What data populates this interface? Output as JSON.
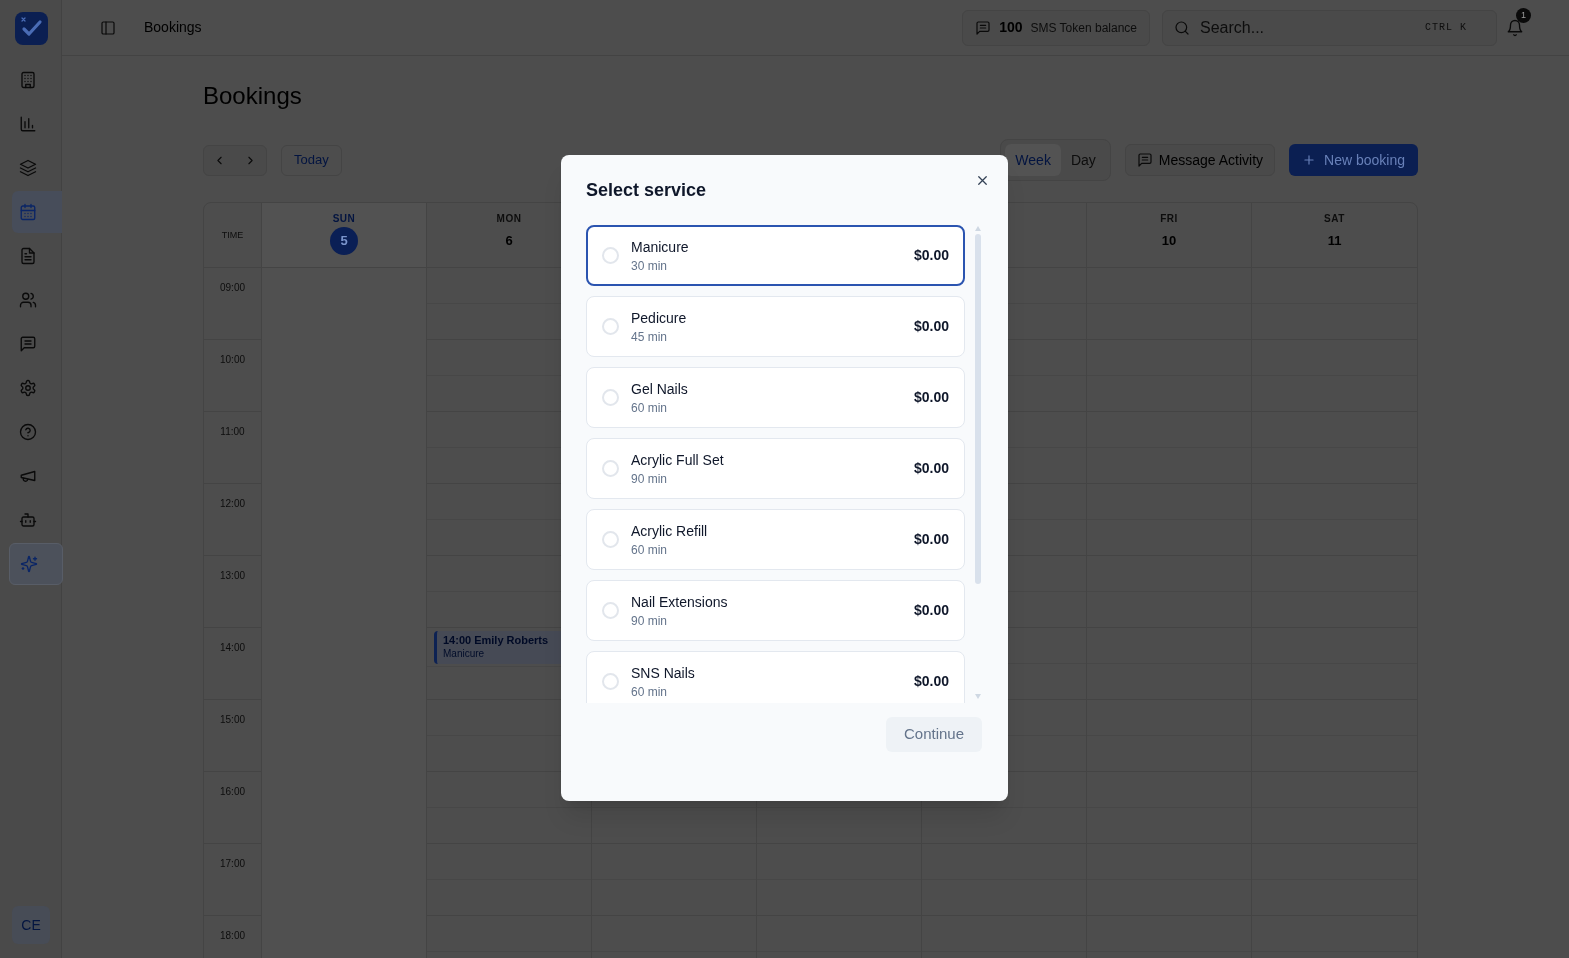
{
  "sidebar": {
    "items": [
      {
        "kind": "nav",
        "selected": false
      },
      {
        "kind": "nav",
        "selected": false
      },
      {
        "kind": "nav",
        "selected": false
      },
      {
        "kind": "nav",
        "selected": true
      },
      {
        "kind": "nav",
        "selected": false
      },
      {
        "kind": "nav",
        "selected": false
      },
      {
        "kind": "nav",
        "selected": false
      },
      {
        "kind": "nav",
        "selected": false
      },
      {
        "kind": "nav",
        "selected": false
      },
      {
        "kind": "nav",
        "selected": false
      },
      {
        "kind": "nav",
        "selected": false
      },
      {
        "kind": "assistant",
        "selected": false
      }
    ],
    "avatar": {
      "initials": "CE"
    }
  },
  "top_bar": {
    "title": "Bookings",
    "sms_balance": {
      "count": "100",
      "label": "SMS Token balance"
    },
    "search": {
      "placeholder": "Search...",
      "shortcut": "CTRL K"
    },
    "notifications": {
      "badge": "1"
    }
  },
  "page": {
    "heading": "Bookings"
  },
  "toolbar": {
    "today": "Today",
    "views": [
      {
        "label": "Week",
        "selected": true
      },
      {
        "label": "Day",
        "selected": false
      }
    ],
    "buttons": [
      {
        "kind": "secondary",
        "label": "Message Activity"
      },
      {
        "kind": "primary",
        "label": "New booking"
      }
    ]
  },
  "calendar": {
    "time_heading": "TIME",
    "days": [
      {
        "name": "SUN",
        "number": "5",
        "today": true
      },
      {
        "name": "MON",
        "number": "6",
        "today": false,
        "bookings": [
          {
            "time": "14:00",
            "client": "Emily Roberts",
            "service": "Manicure"
          }
        ]
      },
      {
        "name": "FRI",
        "number": "10",
        "today": false
      },
      {
        "name": "SAT",
        "number": "11",
        "today": false
      }
    ],
    "hours": [
      "09:00",
      "10:00",
      "11:00",
      "12:00",
      "13:00",
      "14:00",
      "15:00",
      "16:00",
      "17:00",
      "18:00"
    ]
  },
  "modal": {
    "title": "Select service",
    "services": [
      {
        "name": "Manicure",
        "duration": "30 min",
        "price": "$0.00",
        "selected": false,
        "focused": true
      },
      {
        "name": "Pedicure",
        "duration": "45 min",
        "price": "$0.00",
        "selected": false,
        "focused": false
      },
      {
        "name": "Gel Nails",
        "duration": "60 min",
        "price": "$0.00",
        "selected": false,
        "focused": false
      },
      {
        "name": "Acrylic Full Set",
        "duration": "90 min",
        "price": "$0.00",
        "selected": false,
        "focused": false
      },
      {
        "name": "Acrylic Refill",
        "duration": "60 min",
        "price": "$0.00",
        "selected": false,
        "focused": false
      },
      {
        "name": "Nail Extensions",
        "duration": "90 min",
        "price": "$0.00",
        "selected": false,
        "focused": false
      },
      {
        "name": "SNS Nails",
        "duration": "60 min",
        "price": "$0.00",
        "selected": false,
        "focused": false
      }
    ],
    "continue": {
      "label": "Continue",
      "disabled": true
    }
  }
}
